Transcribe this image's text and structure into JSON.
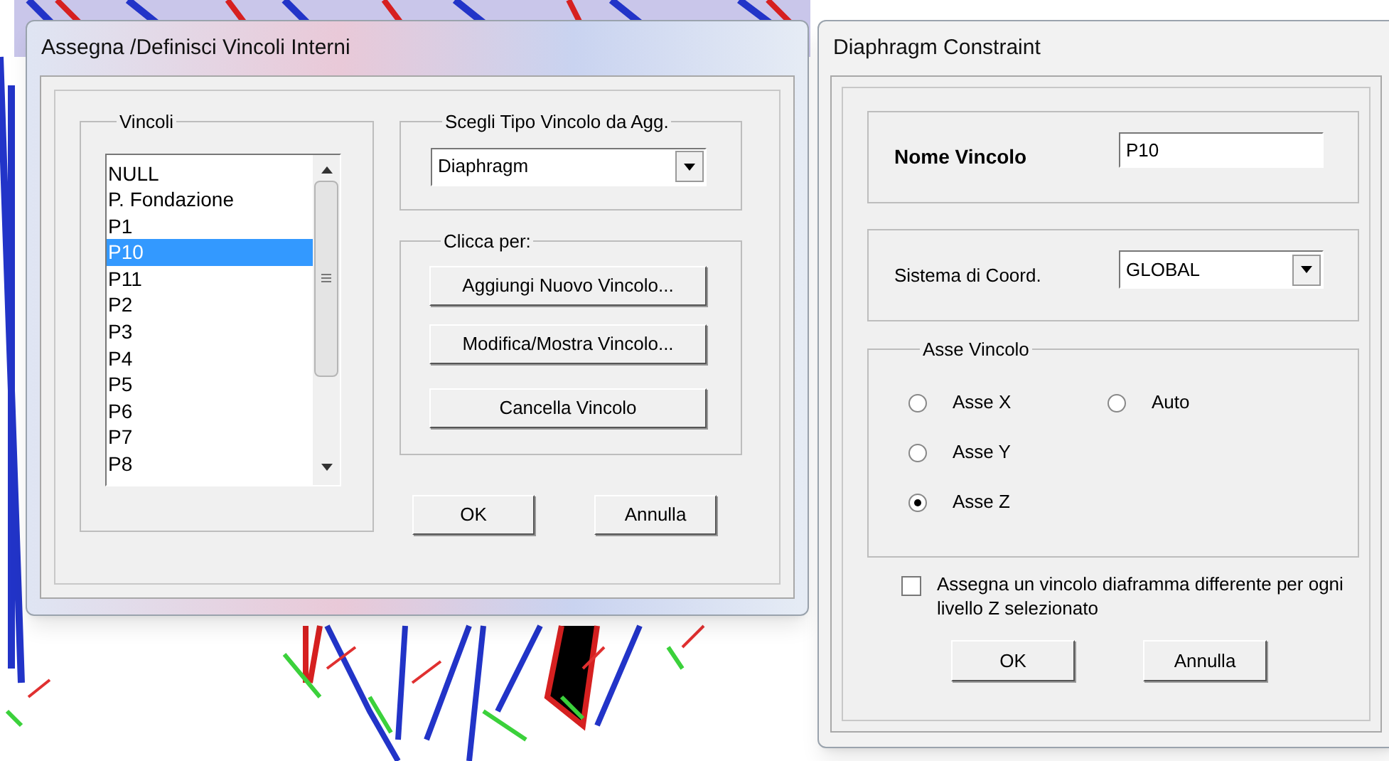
{
  "dialogs": [
    {
      "title": "Assegna /Definisci Vincoli Interni",
      "constraints": {
        "label": "Vincoli",
        "items": [
          {
            "label": "NULL",
            "selected": false
          },
          {
            "label": "P. Fondazione",
            "selected": false
          },
          {
            "label": "P1",
            "selected": false
          },
          {
            "label": "P10",
            "selected": true
          },
          {
            "label": "P11",
            "selected": false
          },
          {
            "label": "P2",
            "selected": false
          },
          {
            "label": "P3",
            "selected": false
          },
          {
            "label": "P4",
            "selected": false
          },
          {
            "label": "P5",
            "selected": false
          },
          {
            "label": "P6",
            "selected": false
          },
          {
            "label": "P7",
            "selected": false
          },
          {
            "label": "P8",
            "selected": false
          }
        ]
      },
      "type_group": {
        "label": "Scegli Tipo Vincolo da Agg.",
        "value": "Diaphragm"
      },
      "actions_group": {
        "label": "Clicca per:",
        "buttons": [
          "Aggiungi Nuovo Vincolo...",
          "Modifica/Mostra Vincolo...",
          "Cancella Vincolo"
        ]
      },
      "buttons": [
        "OK",
        "Annulla"
      ]
    },
    {
      "title": "Diaphragm Constraint",
      "name_field": {
        "label": "Nome Vincolo",
        "value": "P10"
      },
      "coord_field": {
        "label": "Sistema di Coord.",
        "value": "GLOBAL"
      },
      "axis_group": {
        "label": "Asse Vincolo",
        "options": [
          {
            "label": "Asse X",
            "selected": false
          },
          {
            "label": "Auto",
            "selected": false
          },
          {
            "label": "Asse Y",
            "selected": false
          },
          {
            "label": "Asse Z",
            "selected": true
          }
        ]
      },
      "option": {
        "label": "Assegna un vincolo diaframma differente per ogni livello Z selezionato",
        "checked": false
      },
      "buttons": [
        "OK",
        "Annulla"
      ]
    }
  ]
}
